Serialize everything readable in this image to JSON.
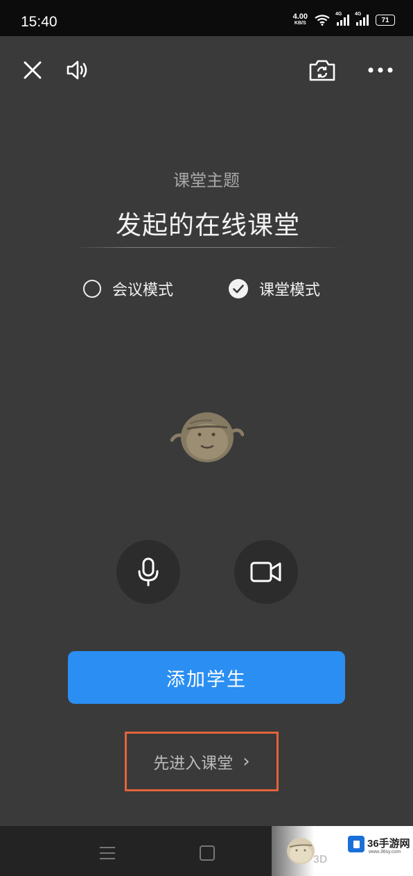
{
  "status_bar": {
    "time": "15:40",
    "net_speed_value": "4.00",
    "net_speed_unit": "KB/S",
    "signal1_label": "4G",
    "signal2_label": "4G",
    "battery": "71"
  },
  "toolbar": {
    "close_icon": "close-icon",
    "speaker_icon": "speaker-icon",
    "camera_switch_icon": "camera-switch-icon",
    "more_icon": "more-icon"
  },
  "room": {
    "caption": "课堂主题",
    "title": "发起的在线课堂"
  },
  "modes": [
    {
      "label": "会议模式",
      "selected": false
    },
    {
      "label": "课堂模式",
      "selected": true
    }
  ],
  "controls": {
    "mic_icon": "microphone-icon",
    "camera_icon": "video-camera-icon"
  },
  "actions": {
    "add_students": "添加学生",
    "enter_class": "先进入课堂",
    "enter_chevron": "›"
  },
  "watermark": {
    "text_3d": "3D",
    "brand": "36手游网",
    "url": "www.36sy.com"
  },
  "colors": {
    "background": "#3a3a3a",
    "primary": "#2a8ef2",
    "highlight": "#e4643a"
  }
}
